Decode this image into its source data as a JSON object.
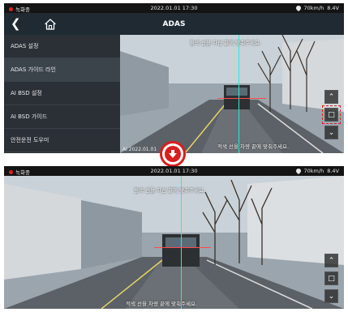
{
  "before": {
    "status": {
      "rec_label": "녹화중",
      "datetime": "2022.01.01 17:30",
      "speed": "70km/h",
      "voltage": "8.4V"
    },
    "title": "ADAS",
    "menu": [
      {
        "label": "ADAS 설정"
      },
      {
        "label": "ADAS 가이드 라인"
      },
      {
        "label": "AI BSD 설정"
      },
      {
        "label": "AI BSD 가이드"
      },
      {
        "label": "안전운전 도우미"
      }
    ],
    "guide_text_top": "흰색 선을 차선 끝에 맞춰주세요.",
    "guide_text_bottom": "적색 선을 차량 끝에 맞춰주세요.",
    "timestamp": "AI 2022.01.01",
    "controls": [
      "up",
      "fit",
      "down"
    ]
  },
  "transition": {
    "icon": "down-arrow-icon"
  },
  "after": {
    "status": {
      "rec_label": "녹화중",
      "datetime": "2022.01.01 17:30",
      "speed": "70km/h",
      "voltage": "8.4V"
    },
    "guide_text_top": "흰색 선을 차선 끝에 맞춰주세요.",
    "guide_text_bottom": "적색 선을 차량 끝에 맞춰주세요."
  },
  "colors": {
    "record": "#e02020",
    "guide_cyan": "#2ee6e6",
    "guide_red": "#ff4a4a",
    "highlight": "#e02020"
  }
}
